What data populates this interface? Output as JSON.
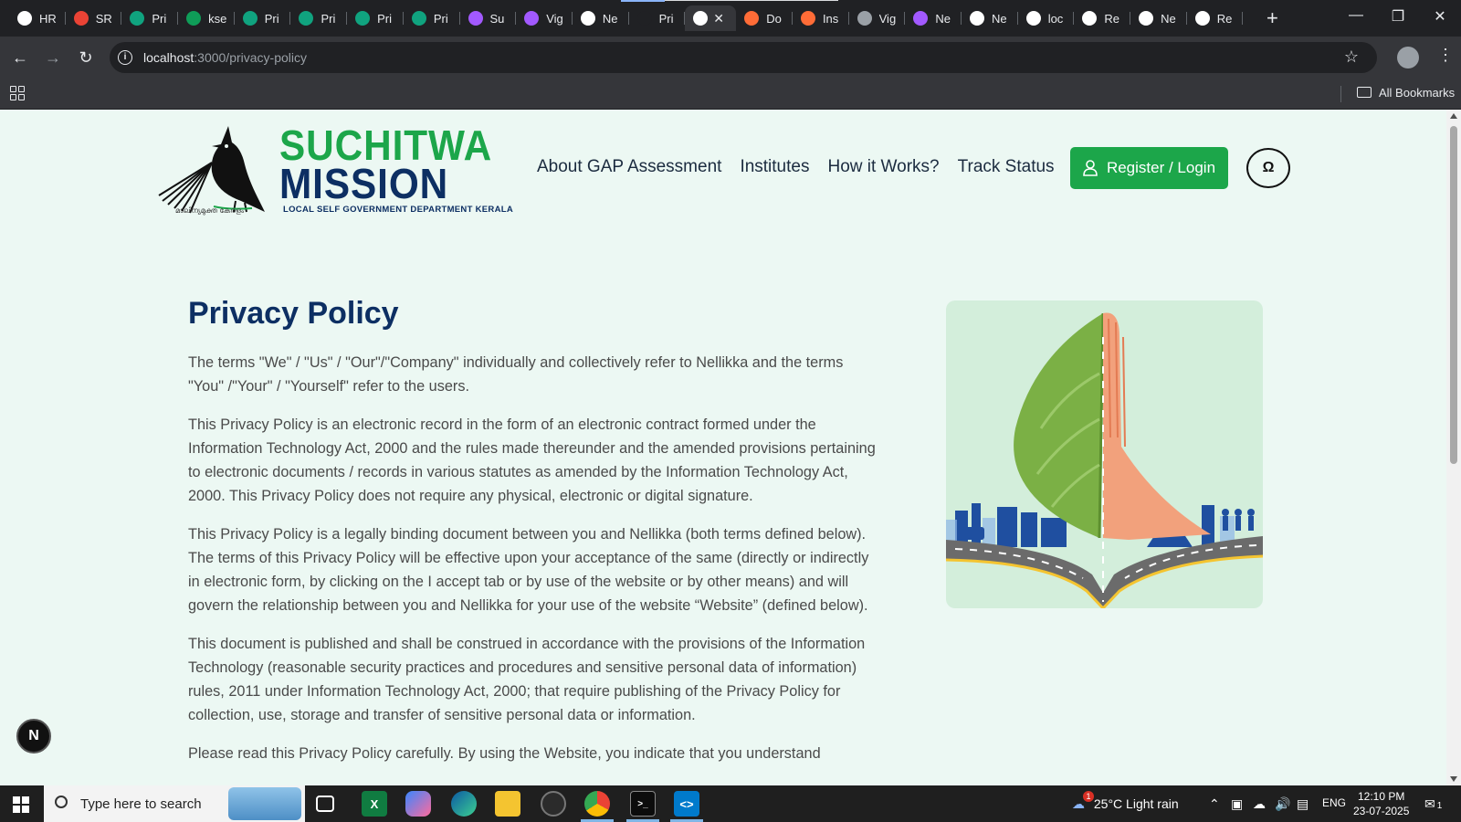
{
  "browser": {
    "tabs": [
      {
        "label": "HR",
        "icon": "notion-like-icon",
        "color": "#ffffff"
      },
      {
        "label": "SR",
        "icon": "gmail-icon",
        "color": "#ea4335"
      },
      {
        "label": "Pri",
        "icon": "chatgpt-icon",
        "color": "#10a37f"
      },
      {
        "label": "kse",
        "icon": "sheets-icon",
        "color": "#0f9d58"
      },
      {
        "label": "Pri",
        "icon": "chatgpt-icon",
        "color": "#10a37f"
      },
      {
        "label": "Pri",
        "icon": "chatgpt-icon",
        "color": "#10a37f"
      },
      {
        "label": "Pri",
        "icon": "chatgpt-icon",
        "color": "#10a37f"
      },
      {
        "label": "Pri",
        "icon": "chatgpt-icon",
        "color": "#10a37f"
      },
      {
        "label": "Su",
        "icon": "figma-icon",
        "color": "#a259ff"
      },
      {
        "label": "Vig",
        "icon": "figma-icon",
        "color": "#a259ff"
      },
      {
        "label": "Ne",
        "icon": "openai-icon",
        "color": "#ffffff"
      },
      {
        "label": "Pri",
        "icon": "blank-icon",
        "color": "#202124"
      },
      {
        "label": "",
        "icon": "vercel-icon",
        "color": "#ffffff",
        "active": true
      },
      {
        "label": "Do",
        "icon": "postman-icon",
        "color": "#ff6c37"
      },
      {
        "label": "Ins",
        "icon": "postman-icon",
        "color": "#ff6c37"
      },
      {
        "label": "Vig",
        "icon": "globe-icon",
        "color": "#9aa0a6"
      },
      {
        "label": "Ne",
        "icon": "figma-icon",
        "color": "#a259ff"
      },
      {
        "label": "Ne",
        "icon": "openai-icon",
        "color": "#ffffff"
      },
      {
        "label": "loc",
        "icon": "vercel-icon",
        "color": "#ffffff"
      },
      {
        "label": "Re",
        "icon": "document-icon",
        "color": "#ffffff"
      },
      {
        "label": "Ne",
        "icon": "openai-icon",
        "color": "#ffffff"
      },
      {
        "label": "Re",
        "icon": "document-icon",
        "color": "#ffffff"
      }
    ],
    "url_host": "localhost",
    "url_path": ":3000/privacy-policy",
    "bookmarks_label": "All Bookmarks"
  },
  "site": {
    "logo_line1": "SUCHITWA",
    "logo_line2": "MISSION",
    "logo_subtitle": "LOCAL SELF GOVERNMENT DEPARTMENT KERALA",
    "logo_malayalam": "മാലിന്യമുക്ത കേരളം",
    "nav": [
      "About GAP Assessment",
      "Institutes",
      "How it Works?",
      "Track Status"
    ],
    "register_label": "Register / Login",
    "accessibility_label": "Ω",
    "brand_green": "#1ca64a",
    "brand_navy": "#0d2f63"
  },
  "policy": {
    "title": "Privacy Policy",
    "paragraphs": [
      "The terms \"We\" / \"Us\" / \"Our\"/\"Company\" individually and collectively refer to Nellikka and the terms \"You\" /\"Your\" / \"Yourself\" refer to the users.",
      "This Privacy Policy is an electronic record in the form of an electronic contract formed under the Information Technology Act, 2000 and the rules made thereunder and the amended provisions pertaining to electronic documents / records in various statutes as amended by the Information Technology Act, 2000. This Privacy Policy does not require any physical, electronic or digital signature.",
      "This Privacy Policy is a legally binding document between you and Nellikka (both terms defined below). The terms of this Privacy Policy will be effective upon your acceptance of the same (directly or indirectly in electronic form, by clicking on the I accept tab or by use of the website or by other means) and will govern the relationship between you and Nellikka for your use of the website “Website” (defined below).",
      "This document is published and shall be construed in accordance with the provisions of the Information Technology (reasonable security practices and procedures and sensitive personal data of information) rules, 2011 under Information Technology Act, 2000; that require publishing of the Privacy Policy for collection, use, storage and transfer of sensitive personal data or information.",
      "Please read this Privacy Policy carefully. By using the Website, you indicate that you understand"
    ]
  },
  "floating_badge": "N",
  "taskbar": {
    "search_placeholder": "Type here to search",
    "weather": "25°C  Light rain",
    "lang": "ENG",
    "time": "12:10 PM",
    "date": "23-07-2025",
    "notifications": "1",
    "weather_badge": "1"
  }
}
